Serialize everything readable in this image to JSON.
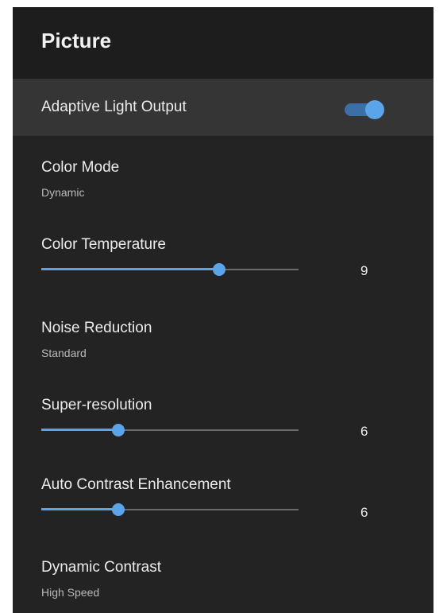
{
  "header": {
    "title": "Picture"
  },
  "items": {
    "adaptive_light": {
      "label": "Adaptive Light Output",
      "enabled": true
    },
    "color_mode": {
      "label": "Color Mode",
      "value": "Dynamic"
    },
    "color_temperature": {
      "label": "Color Temperature",
      "value": "9",
      "level": 0.69
    },
    "noise_reduction": {
      "label": "Noise Reduction",
      "value": "Standard"
    },
    "super_resolution": {
      "label": "Super-resolution",
      "value": "6",
      "level": 0.3
    },
    "auto_contrast": {
      "label": "Auto Contrast Enhancement",
      "value": "6",
      "level": 0.3
    },
    "dynamic_contrast": {
      "label": "Dynamic Contrast",
      "value": "High Speed"
    }
  },
  "colors": {
    "accent": "#5aa4ea",
    "background": "#232323",
    "focus_row": "#353535"
  }
}
